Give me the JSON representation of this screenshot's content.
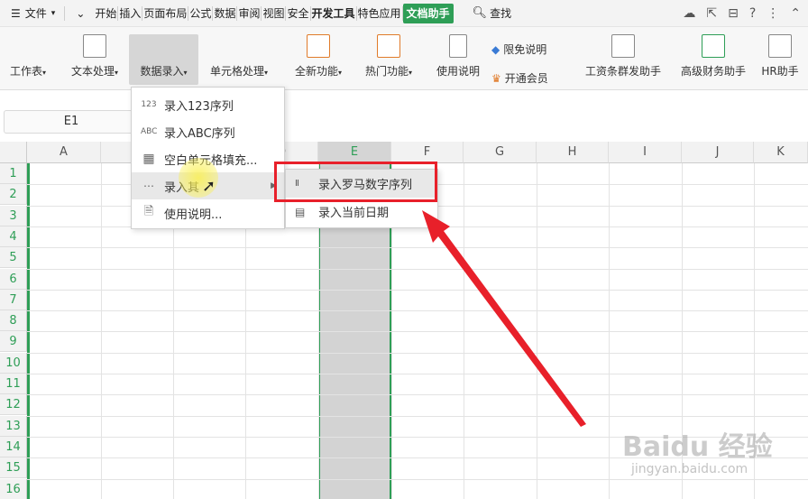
{
  "menubar": {
    "file_label": "文件",
    "tabs": [
      "开始",
      "插入",
      "页面布局",
      "公式",
      "数据",
      "审阅",
      "视图",
      "安全",
      "开发工具",
      "特色应用",
      "文档助手"
    ],
    "active_tab": "文档助手",
    "search_label": "查找"
  },
  "ribbon": {
    "buttons": [
      {
        "label": "工作表",
        "dropdown": true
      },
      {
        "label": "文本处理",
        "dropdown": true
      },
      {
        "label": "数据录入",
        "dropdown": true
      },
      {
        "label": "单元格处理",
        "dropdown": true
      },
      {
        "label": "全新功能",
        "dropdown": true
      },
      {
        "label": "热门功能",
        "dropdown": true
      },
      {
        "label": "使用说明",
        "dropdown": false
      },
      {
        "label": "工资条群发助手",
        "dropdown": false
      },
      {
        "label": "高级财务助手",
        "dropdown": false
      },
      {
        "label": "HR助手",
        "dropdown": false
      }
    ],
    "small": {
      "limit_free": "限免说明",
      "open_member": "开通会员"
    }
  },
  "formulabar": {
    "cell_ref": "E1"
  },
  "columns": [
    "A",
    "B",
    "C",
    "D",
    "E",
    "F",
    "G",
    "H",
    "I",
    "J",
    "K"
  ],
  "selected_column": "E",
  "rows": [
    "1",
    "2",
    "3",
    "4",
    "5",
    "6",
    "7",
    "8",
    "9",
    "10",
    "11",
    "12",
    "13",
    "14",
    "15",
    "16"
  ],
  "dropdown": {
    "items": [
      {
        "icon": "123",
        "label": "录入123序列"
      },
      {
        "icon": "ABC",
        "label": "录入ABC序列"
      },
      {
        "icon": "grid",
        "label": "空白单元格填充..."
      },
      {
        "icon": "other",
        "label": "录入其"
      },
      {
        "icon": "help",
        "label": "使用说明..."
      }
    ]
  },
  "submenu": {
    "items": [
      {
        "icon": "roman",
        "label": "录入罗马数字序列"
      },
      {
        "icon": "calendar",
        "label": "录入当前日期"
      }
    ]
  },
  "watermark": {
    "text": "Baidu 经验",
    "sub": "jingyan.baidu.com"
  },
  "colors": {
    "accent": "#2e9e56",
    "highlight": "#e8202a"
  }
}
